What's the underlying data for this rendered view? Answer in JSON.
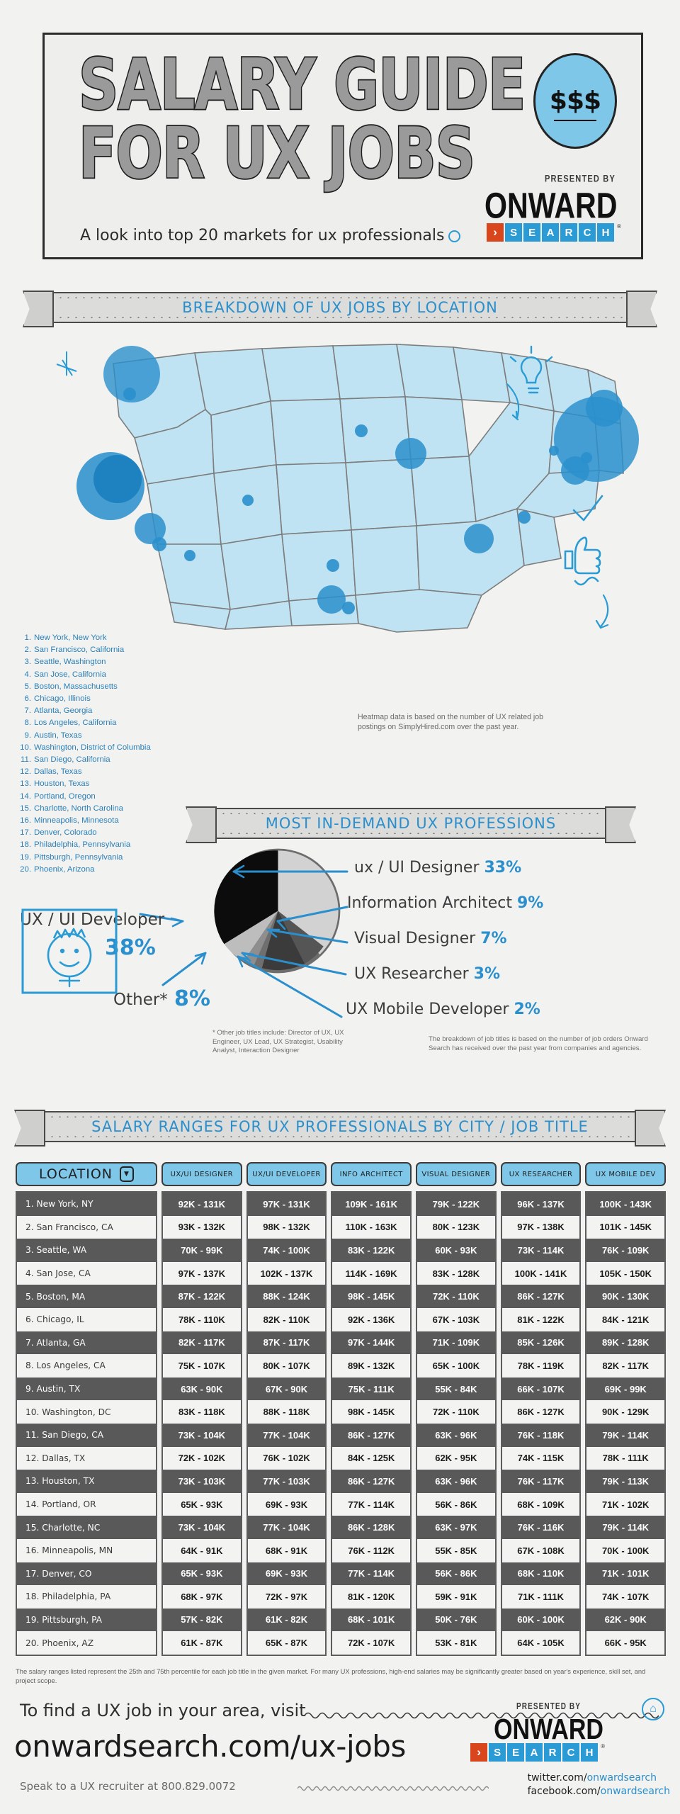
{
  "header": {
    "title": "SALARY GUIDE\nFOR UX JOBS",
    "coin_text": "$$$",
    "presented_by": "PRESENTED BY",
    "brand_onward": "ONWARD",
    "brand_search_letters": [
      "S",
      "E",
      "A",
      "R",
      "C",
      "H"
    ],
    "brand_arrow": "›",
    "registered_mark": "®",
    "subtitle": "A look into top 20 markets for ux professionals"
  },
  "section_map": {
    "banner": "BREAKDOWN OF UX JOBS BY LOCATION",
    "heatmap_note": "Heatmap data is based on the number of UX related job postings on SimplyHired.com over the past year.",
    "cities": [
      {
        "num": "1.",
        "name": "New York, New York"
      },
      {
        "num": "2.",
        "name": "San Francisco, California"
      },
      {
        "num": "3.",
        "name": "Seattle, Washington"
      },
      {
        "num": "4.",
        "name": "San Jose, California"
      },
      {
        "num": "5.",
        "name": "Boston, Massachusetts"
      },
      {
        "num": "6.",
        "name": "Chicago, Illinois"
      },
      {
        "num": "7.",
        "name": "Atlanta, Georgia"
      },
      {
        "num": "8.",
        "name": "Los Angeles, California"
      },
      {
        "num": "9.",
        "name": "Austin, Texas"
      },
      {
        "num": "10.",
        "name": "Washington, District of Columbia"
      },
      {
        "num": "11.",
        "name": "San Diego, California"
      },
      {
        "num": "12.",
        "name": "Dallas, Texas"
      },
      {
        "num": "13.",
        "name": "Houston, Texas"
      },
      {
        "num": "14.",
        "name": "Portland, Oregon"
      },
      {
        "num": "15.",
        "name": "Charlotte, North Carolina"
      },
      {
        "num": "16.",
        "name": "Minneapolis, Minnesota"
      },
      {
        "num": "17.",
        "name": "Denver, Colorado"
      },
      {
        "num": "18.",
        "name": "Philadelphia, Pennsylvania"
      },
      {
        "num": "19.",
        "name": "Pittsburgh, Pennsylvania"
      },
      {
        "num": "20.",
        "name": "Phoenix, Arizona"
      }
    ]
  },
  "section_pie": {
    "banner": "MOST IN-DEMAND UX PROFESSIONS",
    "labels": {
      "developer_name": "UX / UI Developer",
      "developer_pct": "38%",
      "designer_name": "ux / UI Designer",
      "designer_pct": "33%",
      "ia_name": "Information Architect",
      "ia_pct": "9%",
      "visual_name": "Visual Designer",
      "visual_pct": "7%",
      "researcher_name": "UX Researcher",
      "researcher_pct": "3%",
      "mobile_name": "UX Mobile Developer",
      "mobile_pct": "2%",
      "other_name": "Other*",
      "other_pct": "8%"
    },
    "other_note": "* Other job titles include: Director of UX, UX Engineer, UX Lead, UX Strategist, Usability Analyst, Interaction Designer",
    "source_note": "The breakdown of job titles is based on the number of job orders Onward Search has received over the past year from companies and agencies."
  },
  "chart_data": {
    "type": "pie",
    "title": "MOST IN-DEMAND UX PROFESSIONS",
    "categories": [
      "UX / UI Developer",
      "ux / UI Designer",
      "Information Architect",
      "Visual Designer",
      "UX Researcher",
      "UX Mobile Developer",
      "Other*"
    ],
    "values": [
      38,
      33,
      9,
      7,
      3,
      2,
      8
    ],
    "unit": "%",
    "colors": [
      "#0c0c0c",
      "#d2d2d2",
      "#555555",
      "#3b3b3b",
      "#8e8e8e",
      "#6f6f6f",
      "#bdbdbd"
    ],
    "legend": "callout-labels"
  },
  "section_table": {
    "banner": "SALARY RANGES FOR UX PROFESSIONALS BY CITY / JOB TITLE",
    "columns": [
      "LOCATION",
      "UX/UI DESIGNER",
      "UX/UI DEVELOPER",
      "INFO ARCHITECT",
      "VISUAL DESIGNER",
      "UX RESEARCHER",
      "UX MOBILE DEV"
    ],
    "rows": [
      {
        "loc": "1. New York, NY",
        "v": [
          "92K - 131K",
          "97K - 131K",
          "109K - 161K",
          "79K - 122K",
          "96K - 137K",
          "100K - 143K"
        ]
      },
      {
        "loc": "2. San Francisco, CA",
        "v": [
          "93K - 132K",
          "98K - 132K",
          "110K - 163K",
          "80K - 123K",
          "97K - 138K",
          "101K - 145K"
        ]
      },
      {
        "loc": "3. Seattle, WA",
        "v": [
          "70K - 99K",
          "74K - 100K",
          "83K - 122K",
          "60K - 93K",
          "73K - 114K",
          "76K - 109K"
        ]
      },
      {
        "loc": "4. San Jose, CA",
        "v": [
          "97K - 137K",
          "102K - 137K",
          "114K - 169K",
          "83K - 128K",
          "100K - 141K",
          "105K - 150K"
        ]
      },
      {
        "loc": "5. Boston, MA",
        "v": [
          "87K - 122K",
          "88K - 124K",
          "98K - 145K",
          "72K - 110K",
          "86K - 127K",
          "90K - 130K"
        ]
      },
      {
        "loc": "6. Chicago, IL",
        "v": [
          "78K - 110K",
          "82K - 110K",
          "92K - 136K",
          "67K - 103K",
          "81K - 122K",
          "84K - 121K"
        ]
      },
      {
        "loc": "7. Atlanta, GA",
        "v": [
          "82K - 117K",
          "87K - 117K",
          "97K - 144K",
          "71K - 109K",
          "85K - 126K",
          "89K - 128K"
        ]
      },
      {
        "loc": "8. Los Angeles, CA",
        "v": [
          "75K - 107K",
          "80K - 107K",
          "89K - 132K",
          "65K - 100K",
          "78K - 119K",
          "82K - 117K"
        ]
      },
      {
        "loc": "9. Austin, TX",
        "v": [
          "63K - 90K",
          "67K - 90K",
          "75K - 111K",
          "55K - 84K",
          "66K - 107K",
          "69K - 99K"
        ]
      },
      {
        "loc": "10. Washington, DC",
        "v": [
          "83K - 118K",
          "88K - 118K",
          "98K - 145K",
          "72K - 110K",
          "86K - 127K",
          "90K - 129K"
        ]
      },
      {
        "loc": "11. San Diego, CA",
        "v": [
          "73K - 104K",
          "77K - 104K",
          "86K - 127K",
          "63K - 96K",
          "76K - 118K",
          "79K - 114K"
        ]
      },
      {
        "loc": "12. Dallas, TX",
        "v": [
          "72K - 102K",
          "76K - 102K",
          "84K - 125K",
          "62K - 95K",
          "74K - 115K",
          "78K - 111K"
        ]
      },
      {
        "loc": "13. Houston, TX",
        "v": [
          "73K - 103K",
          "77K - 103K",
          "86K - 127K",
          "63K - 96K",
          "76K - 117K",
          "79K - 113K"
        ]
      },
      {
        "loc": "14. Portland, OR",
        "v": [
          "65K - 93K",
          "69K - 93K",
          "77K - 114K",
          "56K - 86K",
          "68K - 109K",
          "71K - 102K"
        ]
      },
      {
        "loc": "15. Charlotte, NC",
        "v": [
          "73K - 104K",
          "77K - 104K",
          "86K - 128K",
          "63K - 97K",
          "76K - 116K",
          "79K - 114K"
        ]
      },
      {
        "loc": "16. Minneapolis, MN",
        "v": [
          "64K - 91K",
          "68K - 91K",
          "76K - 112K",
          "55K - 85K",
          "67K - 108K",
          "70K - 100K"
        ]
      },
      {
        "loc": "17. Denver, CO",
        "v": [
          "65K - 93K",
          "69K - 93K",
          "77K - 114K",
          "56K - 86K",
          "68K - 110K",
          "71K - 101K"
        ]
      },
      {
        "loc": "18. Philadelphia, PA",
        "v": [
          "68K - 97K",
          "72K - 97K",
          "81K - 120K",
          "59K - 91K",
          "71K - 111K",
          "74K - 107K"
        ]
      },
      {
        "loc": "19. Pittsburgh, PA",
        "v": [
          "57K - 82K",
          "61K - 82K",
          "68K - 101K",
          "50K - 76K",
          "60K - 100K",
          "62K - 90K"
        ]
      },
      {
        "loc": "20. Phoenix, AZ",
        "v": [
          "61K - 87K",
          "65K - 87K",
          "72K - 107K",
          "53K - 81K",
          "64K - 105K",
          "66K - 95K"
        ]
      }
    ],
    "note": "The salary ranges listed represent the 25th and 75th percentile for each job title in the given market. For many UX professions, high-end salaries may be significantly greater based on year's experience, skill set, and project scope."
  },
  "footer": {
    "cta": "To find a UX job in your area, visit",
    "url": "onwardsearch.com/ux-jobs",
    "phone": "Speak to a UX recruiter at 800.829.0072",
    "presented_by": "PRESENTED BY",
    "brand_onward": "ONWARD",
    "brand_search_letters": [
      "S",
      "E",
      "A",
      "R",
      "C",
      "H"
    ],
    "brand_arrow": "›",
    "registered_mark": "®",
    "twitter_prefix": "twitter.com/",
    "twitter_handle": "onwardsearch",
    "facebook_prefix": "facebook.com/",
    "facebook_handle": "onwardsearch",
    "home_icon": "⌂"
  },
  "colors": {
    "brand_blue": "#2a9bd4",
    "brand_orange": "#d9451c",
    "map_blue": "#7ec7e8",
    "light_blue": "#bfe3f2"
  }
}
